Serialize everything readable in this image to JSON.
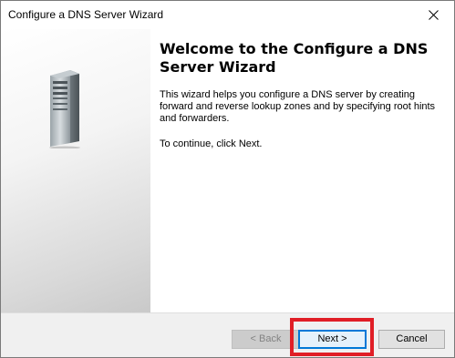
{
  "window": {
    "title": "Configure a DNS Server Wizard"
  },
  "icons": {
    "close": "close-icon",
    "server": "server-icon"
  },
  "content": {
    "heading": "Welcome to the Configure a DNS Server Wizard",
    "description": "This wizard helps you configure a DNS server by creating forward and reverse lookup zones and by specifying root hints and forwarders.",
    "continue_text": "To continue, click Next."
  },
  "buttons": {
    "back": "< Back",
    "next": "Next >",
    "cancel": "Cancel"
  },
  "colors": {
    "highlight": "#e01e26",
    "focus": "#0078d7"
  }
}
